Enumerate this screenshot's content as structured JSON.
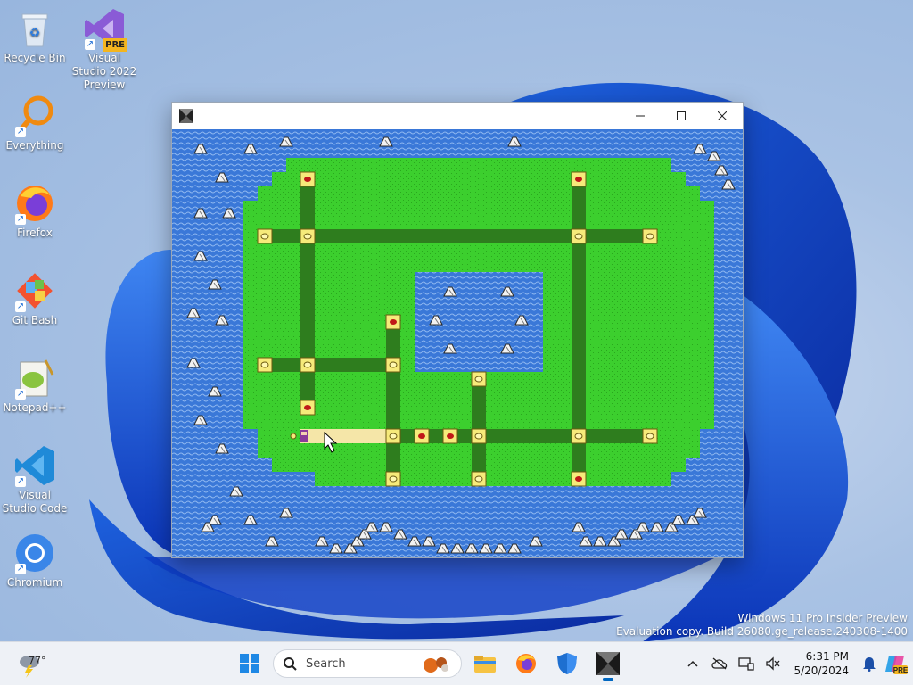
{
  "desktop": {
    "icons": [
      {
        "label": "Recycle Bin"
      },
      {
        "label": "Visual Studio 2022 Preview",
        "badge": "PRE"
      },
      {
        "label": "Everything"
      },
      {
        "label": "Firefox"
      },
      {
        "label": "Git Bash"
      },
      {
        "label": "Notepad++"
      },
      {
        "label": "Visual Studio Code"
      },
      {
        "label": "Chromium"
      }
    ],
    "watermark": {
      "line1": "Windows 11 Pro Insider Preview",
      "line2": "Evaluation copy. Build 26080.ge_release.240308-1400"
    }
  },
  "game_window": {
    "title": "",
    "controls": [
      "minimize",
      "maximize",
      "close"
    ],
    "map": {
      "ocean_color": "#3a78d8",
      "land_color": "#3ccf2e",
      "path_color": "#2e7d1e",
      "visited_path_color": "#f5e6a8",
      "node_colors": {
        "yellow": "#f6ea7a",
        "red": "#c01818"
      }
    }
  },
  "taskbar": {
    "weather": {
      "temp": "77°",
      "icon": "thunderstorm-icon"
    },
    "search": {
      "placeholder": "Search"
    },
    "apps": [
      "start-icon",
      "file-explorer-icon",
      "firefox-icon",
      "defender-icon",
      "game-app-icon"
    ],
    "clock": {
      "time": "6:31 PM",
      "date": "5/20/2024"
    },
    "badge": "PRE"
  }
}
